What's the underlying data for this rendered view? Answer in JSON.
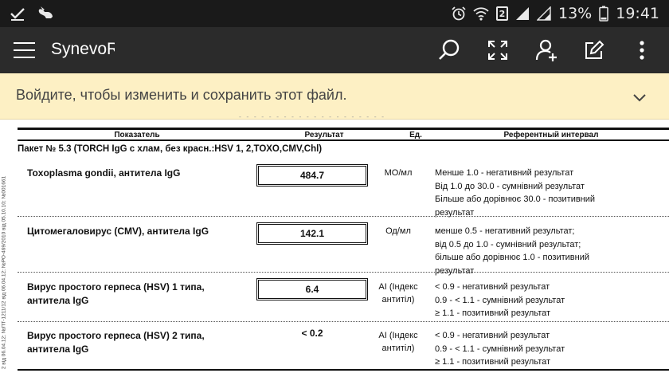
{
  "status_bar": {
    "battery_percent": "13%",
    "time": "19:41",
    "sim_badge": "2"
  },
  "app_bar": {
    "title": "SynevoRe"
  },
  "banner": {
    "text": "Войдите, чтобы изменить и сохранить этот файл."
  },
  "document": {
    "side_stamp": "2 вiд 06.04.12; №ПТ-1211/12 вiд 06.04.12; №РО-469/2010 вiд 05.10.10; №001661",
    "headers": {
      "indicator": "Показатель",
      "result": "Результат",
      "unit": "Ед.",
      "reference": "Референтный интервал"
    },
    "package_title": "Пакет № 5.3 (TORCH IgG с хлам, без красн.:HSV 1, 2,TOXO,CMV,Chl)",
    "rows": [
      {
        "name_lines": [
          "Toxoplasma gondii, антитела IgG"
        ],
        "value": "484.7",
        "boxed": true,
        "unit_lines": [
          "МО/мл"
        ],
        "reference_lines": [
          "Менше 1.0 - негативний результат",
          "Вiд 1.0 до 30.0 - сумнiвний результат",
          "Бiльше або дорiвнює 30.0 - позитивний",
          "результат"
        ]
      },
      {
        "name_lines": [
          "Цитомегаловирус (CMV), антитела IgG"
        ],
        "value": "142.1",
        "boxed": true,
        "unit_lines": [
          "Од/мл"
        ],
        "reference_lines": [
          "менше 0.5 - негативний результат;",
          "вiд 0.5 до 1.0 - сумнiвний результат;",
          "бiльше або дорiвнює 1.0 - позитивний",
          "результат"
        ]
      },
      {
        "name_lines": [
          "Вирус простого герпеса (HSV) 1 типа,",
          "антитела IgG"
        ],
        "value": "6.4",
        "boxed": true,
        "unit_lines": [
          "AI (Iндекс",
          "антитiл)"
        ],
        "reference_lines": [
          "< 0.9 - негативний результат",
          "0.9  - < 1.1 - сумнiвний результат",
          "≥ 1.1 - позитивний результат"
        ]
      },
      {
        "name_lines": [
          "Вирус простого герпеса (HSV) 2 типа,",
          "антитела IgG"
        ],
        "value": "< 0.2",
        "boxed": false,
        "unit_lines": [
          "AI (Iндекс",
          "антитiл)"
        ],
        "reference_lines": [
          "< 0.9 - негативний результат",
          "0.9  - < 1.1 - сумнiвний результат",
          "≥ 1.1 - позитивний результат"
        ]
      }
    ]
  }
}
